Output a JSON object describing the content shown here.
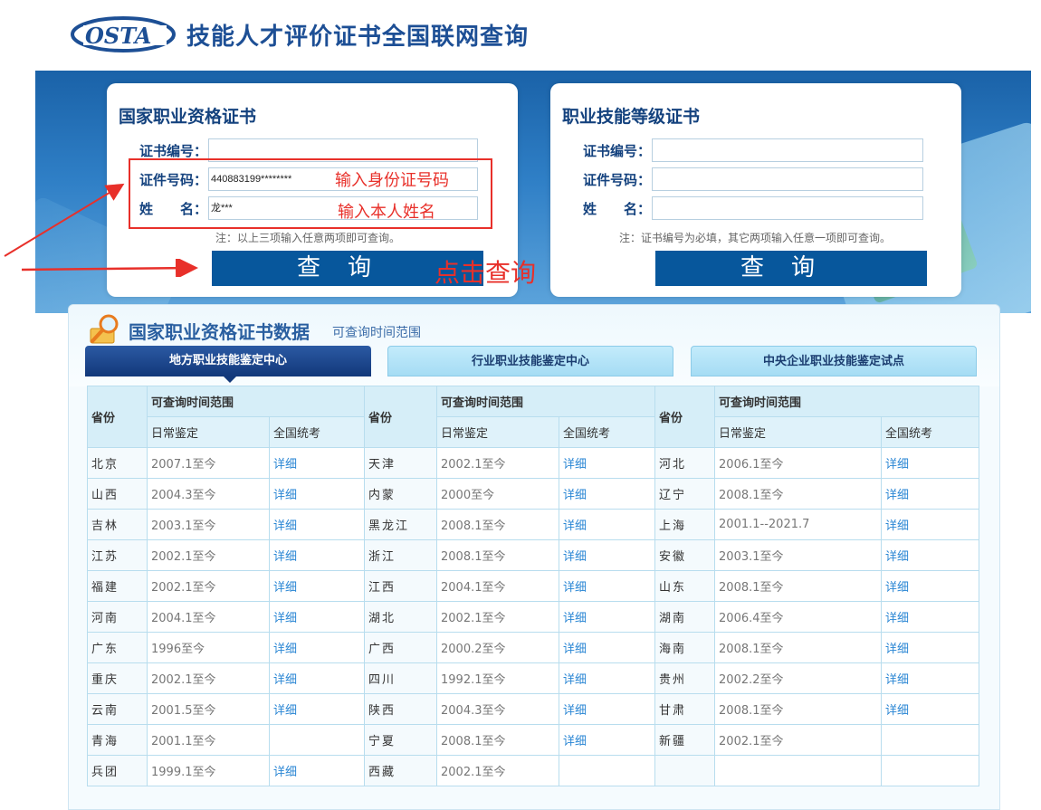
{
  "header": {
    "logo_text": "OSTA",
    "title": "技能人才评价证书全国联网查询"
  },
  "left_form": {
    "title": "国家职业资格证书",
    "fields": [
      {
        "label": "证书编号：",
        "value": ""
      },
      {
        "label": "证件号码：",
        "value": "440883199********"
      },
      {
        "label": "姓　　名：",
        "value": "龙***"
      }
    ],
    "note": "注：以上三项输入任意两项即可查询。",
    "button": "查询"
  },
  "right_form": {
    "title": "职业技能等级证书",
    "fields": [
      {
        "label": "证书编号：",
        "value": ""
      },
      {
        "label": "证件号码：",
        "value": ""
      },
      {
        "label": "姓　　名：",
        "value": ""
      }
    ],
    "note": "注：证书编号为必填，其它两项输入任意一项即可查询。",
    "button": "查询"
  },
  "annotations": {
    "id_hint": "输入身份证号码",
    "name_hint": "输入本人姓名",
    "click_hint": "点击查询",
    "color": "#e8302a"
  },
  "panel": {
    "title": "国家职业资格证书数据",
    "subtitle": "可查询时间范围",
    "tabs": [
      "地方职业技能鉴定中心",
      "行业职业技能鉴定中心",
      "中央企业职业技能鉴定试点"
    ]
  },
  "table": {
    "header": {
      "province": "省份",
      "range": "可查询时间范围",
      "daily": "日常鉴定",
      "national": "全国统考"
    },
    "rows": [
      [
        [
          "北京",
          "2007.1至今",
          "详细"
        ],
        [
          "天津",
          "2002.1至今",
          "详细"
        ],
        [
          "河北",
          "2006.1至今",
          "详细"
        ]
      ],
      [
        [
          "山西",
          "2004.3至今",
          "详细"
        ],
        [
          "内蒙",
          "2000至今",
          "详细"
        ],
        [
          "辽宁",
          "2008.1至今",
          "详细"
        ]
      ],
      [
        [
          "吉林",
          "2003.1至今",
          "详细"
        ],
        [
          "黑龙江",
          "2008.1至今",
          "详细"
        ],
        [
          "上海",
          "2001.1--2021.7",
          "详细"
        ]
      ],
      [
        [
          "江苏",
          "2002.1至今",
          "详细"
        ],
        [
          "浙江",
          "2008.1至今",
          "详细"
        ],
        [
          "安徽",
          "2003.1至今",
          "详细"
        ]
      ],
      [
        [
          "福建",
          "2002.1至今",
          "详细"
        ],
        [
          "江西",
          "2004.1至今",
          "详细"
        ],
        [
          "山东",
          "2008.1至今",
          "详细"
        ]
      ],
      [
        [
          "河南",
          "2004.1至今",
          "详细"
        ],
        [
          "湖北",
          "2002.1至今",
          "详细"
        ],
        [
          "湖南",
          "2006.4至今",
          "详细"
        ]
      ],
      [
        [
          "广东",
          "1996至今",
          "详细"
        ],
        [
          "广西",
          "2000.2至今",
          "详细"
        ],
        [
          "海南",
          "2008.1至今",
          "详细"
        ]
      ],
      [
        [
          "重庆",
          "2002.1至今",
          "详细"
        ],
        [
          "四川",
          "1992.1至今",
          "详细"
        ],
        [
          "贵州",
          "2002.2至今",
          "详细"
        ]
      ],
      [
        [
          "云南",
          "2001.5至今",
          "详细"
        ],
        [
          "陕西",
          "2004.3至今",
          "详细"
        ],
        [
          "甘肃",
          "2008.1至今",
          "详细"
        ]
      ],
      [
        [
          "青海",
          "2001.1至今",
          ""
        ],
        [
          "宁夏",
          "2008.1至今",
          "详细"
        ],
        [
          "新疆",
          "2002.1至今",
          ""
        ]
      ],
      [
        [
          "兵团",
          "1999.1至今",
          "详细"
        ],
        [
          "西藏",
          "2002.1至今",
          ""
        ],
        [
          "",
          "",
          ""
        ]
      ]
    ]
  }
}
